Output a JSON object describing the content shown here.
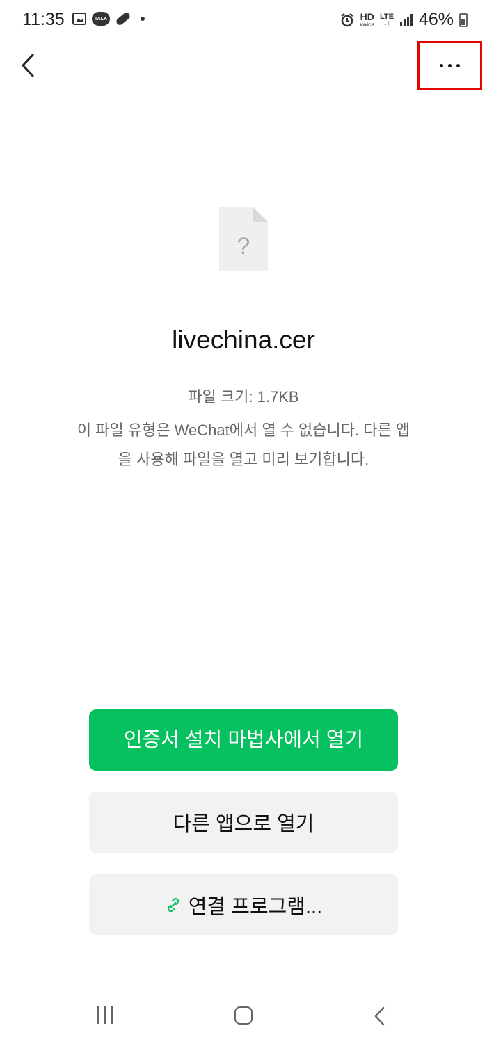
{
  "status_bar": {
    "time": "11:35",
    "talk_label": "TALK",
    "hd_label": "HD",
    "voice_label": "voice",
    "lte_label": "LTE",
    "battery": "46%"
  },
  "file": {
    "name": "livechina.cer",
    "size_text": "파일 크기: 1.7KB",
    "description": "이 파일 유형은 WeChat에서 열 수 없습니다. 다른 앱을 사용해 파일을 열고 미리 보기합니다."
  },
  "actions": {
    "primary_label": "인증서 설치 마법사에서 열기",
    "secondary_label": "다른 앱으로 열기",
    "link_label": "연결 프로그램..."
  },
  "colors": {
    "primary_green": "#07c160",
    "highlight_red": "#e10600"
  }
}
